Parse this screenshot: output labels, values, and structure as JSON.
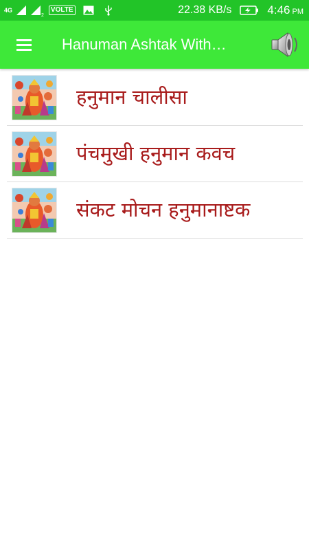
{
  "status_bar": {
    "network_type": "4G",
    "sim_numbers": [
      "",
      "2"
    ],
    "volte": "VOLTE",
    "speed": "22.38 KB/s",
    "time": "4:46",
    "ampm": "PM",
    "icons": [
      "signal-icon",
      "gallery-icon",
      "usb-icon",
      "battery-charging-icon"
    ]
  },
  "app_bar": {
    "title": "Hanuman Ashtak With…",
    "menu_icon": "hamburger-menu-icon",
    "action_icon": "speaker-icon"
  },
  "list": {
    "items": [
      {
        "label": "हनुमान चालीसा",
        "thumbnail": "hanuman-image"
      },
      {
        "label": "पंचमुखी हनुमान कवच",
        "thumbnail": "hanuman-image"
      },
      {
        "label": "संकट मोचन हनुमानाष्टक",
        "thumbnail": "hanuman-image"
      }
    ]
  },
  "colors": {
    "status_bar": "#22c428",
    "app_bar": "#3ee839",
    "item_text": "#a81b1b",
    "divider": "#dddddd"
  }
}
